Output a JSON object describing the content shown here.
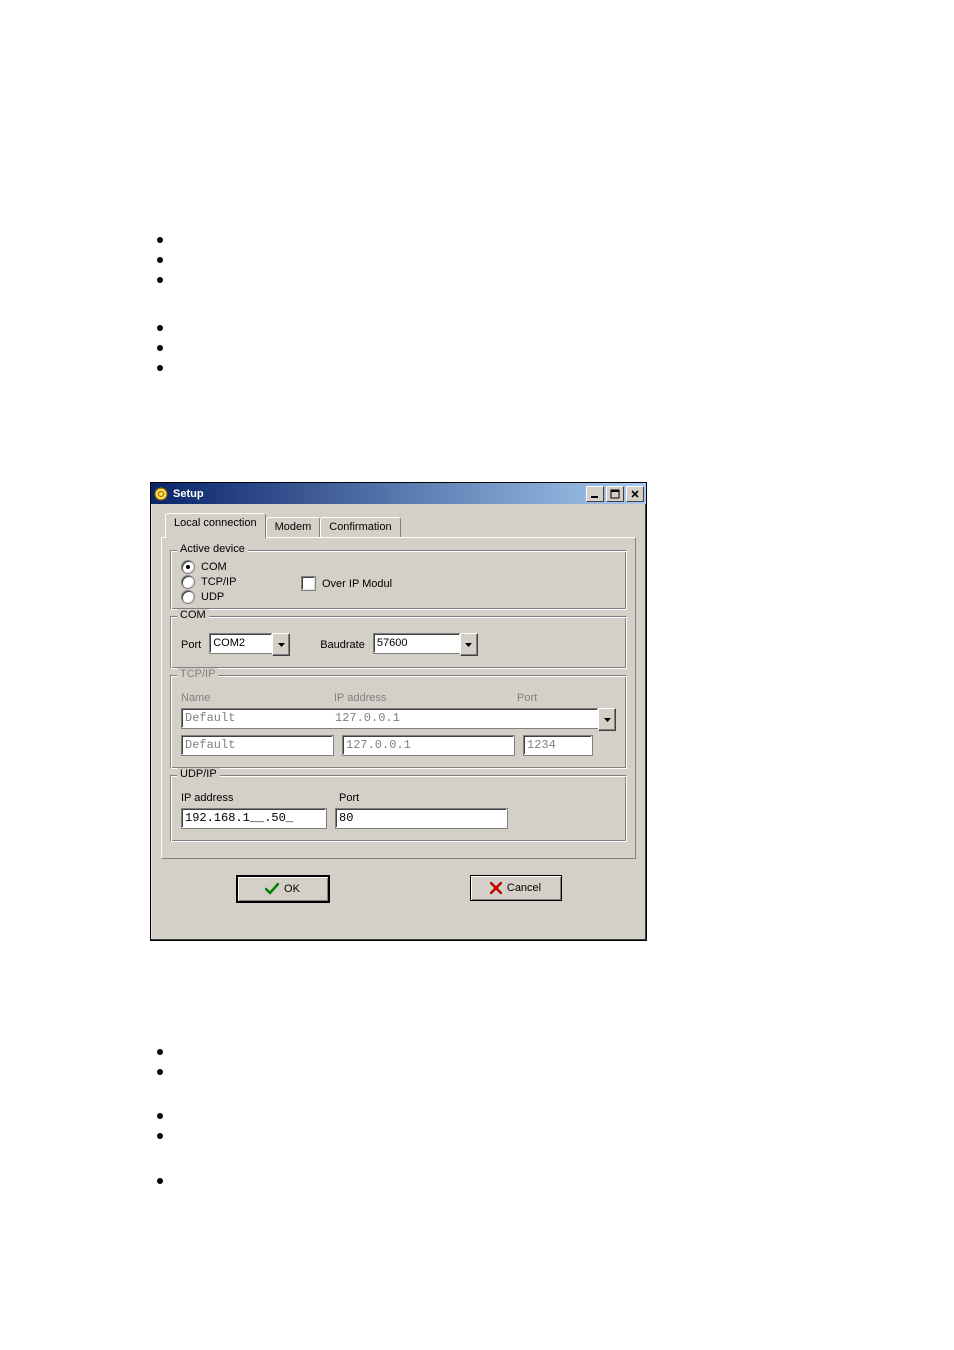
{
  "window": {
    "title": "Setup"
  },
  "tabs": {
    "local": "Local connection",
    "modem": "Modem",
    "confirmation": "Confirmation"
  },
  "group_active": {
    "legend": "Active device",
    "opt_com": "COM",
    "opt_tcpip": "TCP/IP",
    "opt_udp": "UDP",
    "chk_overip": "Over IP Modul"
  },
  "group_com": {
    "legend": "COM",
    "lbl_port": "Port",
    "val_port": "COM2",
    "lbl_baud": "Baudrate",
    "val_baud": "57600"
  },
  "group_tcpip": {
    "legend": "TCP/IP",
    "hdr_name": "Name",
    "hdr_ip": "IP address",
    "hdr_port": "Port",
    "row1_name": "Default",
    "row1_ip": "127.0.0.1",
    "row2_name": "Default",
    "row2_ip": "127.0.0.1",
    "row2_port": "1234"
  },
  "group_udp": {
    "legend": "UDP/IP",
    "lbl_ip": "IP address",
    "lbl_port": "Port",
    "val_ip": "192.168.1__.50_",
    "val_port": "80"
  },
  "buttons": {
    "ok": "OK",
    "cancel": "Cancel"
  },
  "colors": {
    "ok_icon": "#008000",
    "cancel_icon": "#c00000"
  }
}
